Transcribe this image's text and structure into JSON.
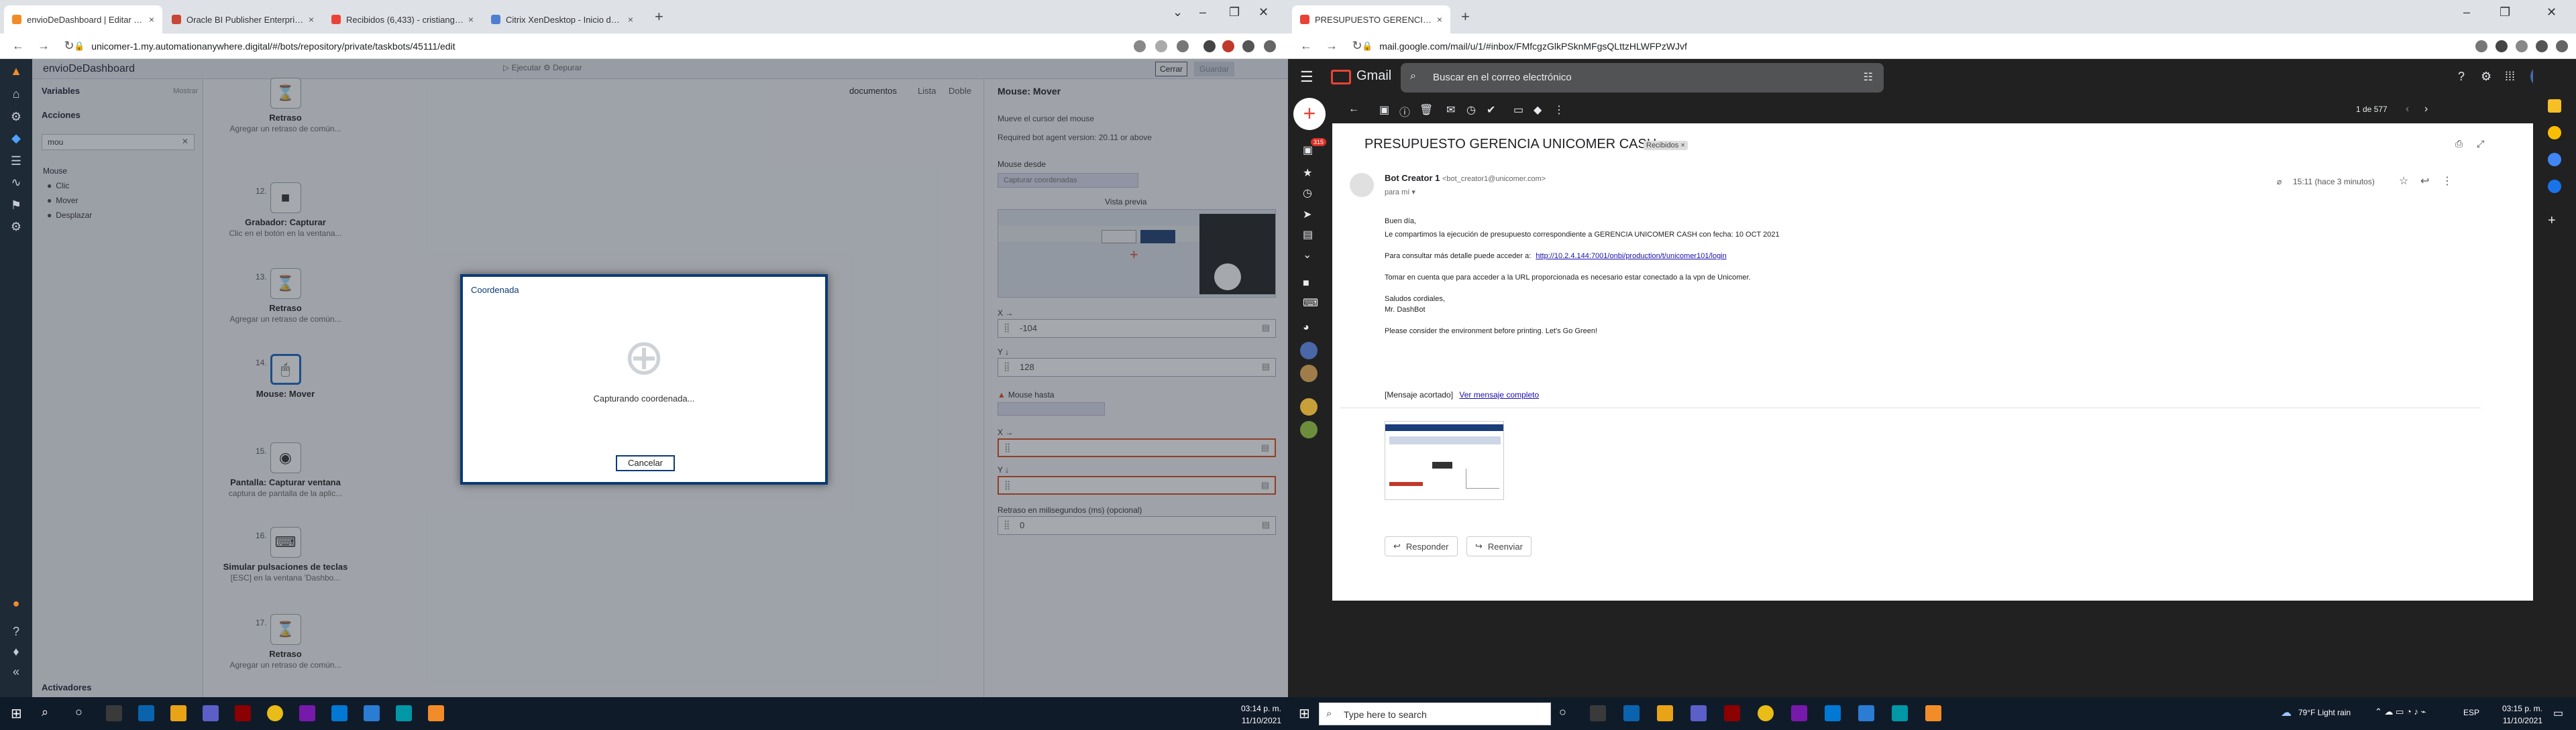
{
  "left_browser": {
    "tabs": [
      {
        "label": "envioDeDashboard | Editar Tas..."
      },
      {
        "label": "Oracle BI Publisher Enterprise Lo..."
      },
      {
        "label": "Recibidos (6,433) - cristiangom..."
      },
      {
        "label": "Citrix XenDesktop - Inicio de se..."
      }
    ],
    "url": "unicomer-1.my.automationanywhere.digital/#/bots/repository/private/taskbots/45111/edit"
  },
  "aa_app": {
    "bot_name": "envioDeDashboard",
    "header_buttons": {
      "run": "Ejecutar",
      "debug": "Depurar",
      "close": "Cerrar",
      "save": "Guardar"
    },
    "left_panel": {
      "variables": "Variables",
      "actions": "Acciones",
      "search_value": "mou",
      "group": "Mouse",
      "items": [
        "Clic",
        "Mover",
        "Desplazar"
      ],
      "triggers": "Activadores",
      "collapse": "Mostrar"
    },
    "steps": [
      {
        "num": "",
        "title": "Retraso",
        "subtitle": "Agregar un retraso de común..."
      },
      {
        "num": "12.",
        "title": "Grabador: Capturar",
        "subtitle": "Clic en el botón en la ventana..."
      },
      {
        "num": "13.",
        "title": "Retraso",
        "subtitle": "Agregar un retraso de común..."
      },
      {
        "num": "14.",
        "title": "Mouse: Mover",
        "subtitle": ""
      },
      {
        "num": "15.",
        "title": "Pantalla: Capturar ventana",
        "subtitle": "captura de pantalla de la aplic..."
      },
      {
        "num": "16.",
        "title": "Simular pulsaciones de teclas",
        "subtitle": "[ESC] en la ventana 'Dashbo..."
      },
      {
        "num": "17.",
        "title": "Retraso",
        "subtitle": "Agregar un retraso de común..."
      }
    ],
    "view_tabs": [
      "documentos",
      "Lista",
      "Doble"
    ],
    "properties": {
      "title": "Mouse: Mover",
      "description": "Mueve el cursor del mouse",
      "version": "Required bot agent version: 20.11 or above",
      "move_from": "Mouse desde",
      "capture_btn": "Capturar coordenadas",
      "preview": "Vista previa",
      "x_label": "X →",
      "x_value": "-104",
      "y_label": "Y ↓",
      "y_value": "128",
      "move_to": "Mouse hasta",
      "x2_label": "X →",
      "y2_label": "Y ↓",
      "delay_label": "Retraso en milisegundos (ms) (opcional)",
      "delay_value": "0"
    },
    "dialog": {
      "title": "Coordenada",
      "message": "Capturando coordenada...",
      "cancel": "Cancelar"
    }
  },
  "right_browser": {
    "tabs": [
      {
        "label": "PRESUPUESTO GERENCIA UNIC..."
      }
    ],
    "url": "mail.google.com/mail/u/1/#inbox/FMfcgzGlkPSknMFgsQLttzHLWFPzWJvf"
  },
  "gmail": {
    "brand": "Gmail",
    "search_placeholder": "Buscar en el correo electrónico",
    "inbox_count": "315",
    "pager": "1 de 577",
    "subject": "PRESUPUESTO GERENCIA UNICOMER CASH",
    "label_chip": "Recibidos ×",
    "sender_name": "Bot Creator 1",
    "sender_email": "<bot_creator1@unicomer.com>",
    "to": "para mí",
    "time": "15:11 (hace 3 minutos)",
    "body": [
      "Buen día,",
      "Le compartimos la ejecución de presupuesto correspondiente a  GERENCIA UNICOMER CASH con fecha:  10 OCT 2021",
      "Para consultar más detalle puede acceder a:",
      "Tomar en cuenta que para acceder a la URL proporcionada es necesario estar conectado a la vpn de Unicomer.",
      "Saludos cordiales,",
      "Mr. DashBot",
      "Please consider the environment before printing. Let's Go Green!"
    ],
    "link": "http://10.2.4.144:7001/onbi/production/t/unicomer101/login",
    "trimmed": "[Mensaje acortado]",
    "full_message": "Ver mensaje completo",
    "reply": "Responder",
    "forward": "Reenviar"
  },
  "taskbar": {
    "left_time": "03:14 p. m.",
    "left_date": "11/10/2021",
    "search_placeholder": "Type here to search",
    "weather": "79°F  Light rain",
    "lang": "ESP",
    "right_time": "03:15 p. m.",
    "right_date": "11/10/2021"
  }
}
